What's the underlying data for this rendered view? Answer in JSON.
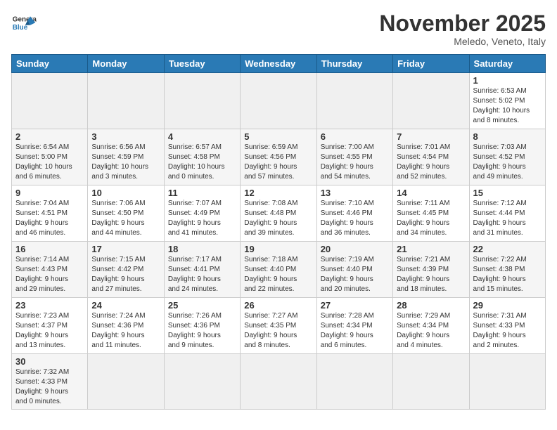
{
  "header": {
    "logo_general": "General",
    "logo_blue": "Blue",
    "month_title": "November 2025",
    "location": "Meledo, Veneto, Italy"
  },
  "weekdays": [
    "Sunday",
    "Monday",
    "Tuesday",
    "Wednesday",
    "Thursday",
    "Friday",
    "Saturday"
  ],
  "weeks": [
    [
      {
        "day": "",
        "info": ""
      },
      {
        "day": "",
        "info": ""
      },
      {
        "day": "",
        "info": ""
      },
      {
        "day": "",
        "info": ""
      },
      {
        "day": "",
        "info": ""
      },
      {
        "day": "",
        "info": ""
      },
      {
        "day": "1",
        "info": "Sunrise: 6:53 AM\nSunset: 5:02 PM\nDaylight: 10 hours\nand 8 minutes."
      }
    ],
    [
      {
        "day": "2",
        "info": "Sunrise: 6:54 AM\nSunset: 5:00 PM\nDaylight: 10 hours\nand 6 minutes."
      },
      {
        "day": "3",
        "info": "Sunrise: 6:56 AM\nSunset: 4:59 PM\nDaylight: 10 hours\nand 3 minutes."
      },
      {
        "day": "4",
        "info": "Sunrise: 6:57 AM\nSunset: 4:58 PM\nDaylight: 10 hours\nand 0 minutes."
      },
      {
        "day": "5",
        "info": "Sunrise: 6:59 AM\nSunset: 4:56 PM\nDaylight: 9 hours\nand 57 minutes."
      },
      {
        "day": "6",
        "info": "Sunrise: 7:00 AM\nSunset: 4:55 PM\nDaylight: 9 hours\nand 54 minutes."
      },
      {
        "day": "7",
        "info": "Sunrise: 7:01 AM\nSunset: 4:54 PM\nDaylight: 9 hours\nand 52 minutes."
      },
      {
        "day": "8",
        "info": "Sunrise: 7:03 AM\nSunset: 4:52 PM\nDaylight: 9 hours\nand 49 minutes."
      }
    ],
    [
      {
        "day": "9",
        "info": "Sunrise: 7:04 AM\nSunset: 4:51 PM\nDaylight: 9 hours\nand 46 minutes."
      },
      {
        "day": "10",
        "info": "Sunrise: 7:06 AM\nSunset: 4:50 PM\nDaylight: 9 hours\nand 44 minutes."
      },
      {
        "day": "11",
        "info": "Sunrise: 7:07 AM\nSunset: 4:49 PM\nDaylight: 9 hours\nand 41 minutes."
      },
      {
        "day": "12",
        "info": "Sunrise: 7:08 AM\nSunset: 4:48 PM\nDaylight: 9 hours\nand 39 minutes."
      },
      {
        "day": "13",
        "info": "Sunrise: 7:10 AM\nSunset: 4:46 PM\nDaylight: 9 hours\nand 36 minutes."
      },
      {
        "day": "14",
        "info": "Sunrise: 7:11 AM\nSunset: 4:45 PM\nDaylight: 9 hours\nand 34 minutes."
      },
      {
        "day": "15",
        "info": "Sunrise: 7:12 AM\nSunset: 4:44 PM\nDaylight: 9 hours\nand 31 minutes."
      }
    ],
    [
      {
        "day": "16",
        "info": "Sunrise: 7:14 AM\nSunset: 4:43 PM\nDaylight: 9 hours\nand 29 minutes."
      },
      {
        "day": "17",
        "info": "Sunrise: 7:15 AM\nSunset: 4:42 PM\nDaylight: 9 hours\nand 27 minutes."
      },
      {
        "day": "18",
        "info": "Sunrise: 7:17 AM\nSunset: 4:41 PM\nDaylight: 9 hours\nand 24 minutes."
      },
      {
        "day": "19",
        "info": "Sunrise: 7:18 AM\nSunset: 4:40 PM\nDaylight: 9 hours\nand 22 minutes."
      },
      {
        "day": "20",
        "info": "Sunrise: 7:19 AM\nSunset: 4:40 PM\nDaylight: 9 hours\nand 20 minutes."
      },
      {
        "day": "21",
        "info": "Sunrise: 7:21 AM\nSunset: 4:39 PM\nDaylight: 9 hours\nand 18 minutes."
      },
      {
        "day": "22",
        "info": "Sunrise: 7:22 AM\nSunset: 4:38 PM\nDaylight: 9 hours\nand 15 minutes."
      }
    ],
    [
      {
        "day": "23",
        "info": "Sunrise: 7:23 AM\nSunset: 4:37 PM\nDaylight: 9 hours\nand 13 minutes."
      },
      {
        "day": "24",
        "info": "Sunrise: 7:24 AM\nSunset: 4:36 PM\nDaylight: 9 hours\nand 11 minutes."
      },
      {
        "day": "25",
        "info": "Sunrise: 7:26 AM\nSunset: 4:36 PM\nDaylight: 9 hours\nand 9 minutes."
      },
      {
        "day": "26",
        "info": "Sunrise: 7:27 AM\nSunset: 4:35 PM\nDaylight: 9 hours\nand 8 minutes."
      },
      {
        "day": "27",
        "info": "Sunrise: 7:28 AM\nSunset: 4:34 PM\nDaylight: 9 hours\nand 6 minutes."
      },
      {
        "day": "28",
        "info": "Sunrise: 7:29 AM\nSunset: 4:34 PM\nDaylight: 9 hours\nand 4 minutes."
      },
      {
        "day": "29",
        "info": "Sunrise: 7:31 AM\nSunset: 4:33 PM\nDaylight: 9 hours\nand 2 minutes."
      }
    ],
    [
      {
        "day": "30",
        "info": "Sunrise: 7:32 AM\nSunset: 4:33 PM\nDaylight: 9 hours\nand 0 minutes."
      },
      {
        "day": "",
        "info": ""
      },
      {
        "day": "",
        "info": ""
      },
      {
        "day": "",
        "info": ""
      },
      {
        "day": "",
        "info": ""
      },
      {
        "day": "",
        "info": ""
      },
      {
        "day": "",
        "info": ""
      }
    ]
  ]
}
